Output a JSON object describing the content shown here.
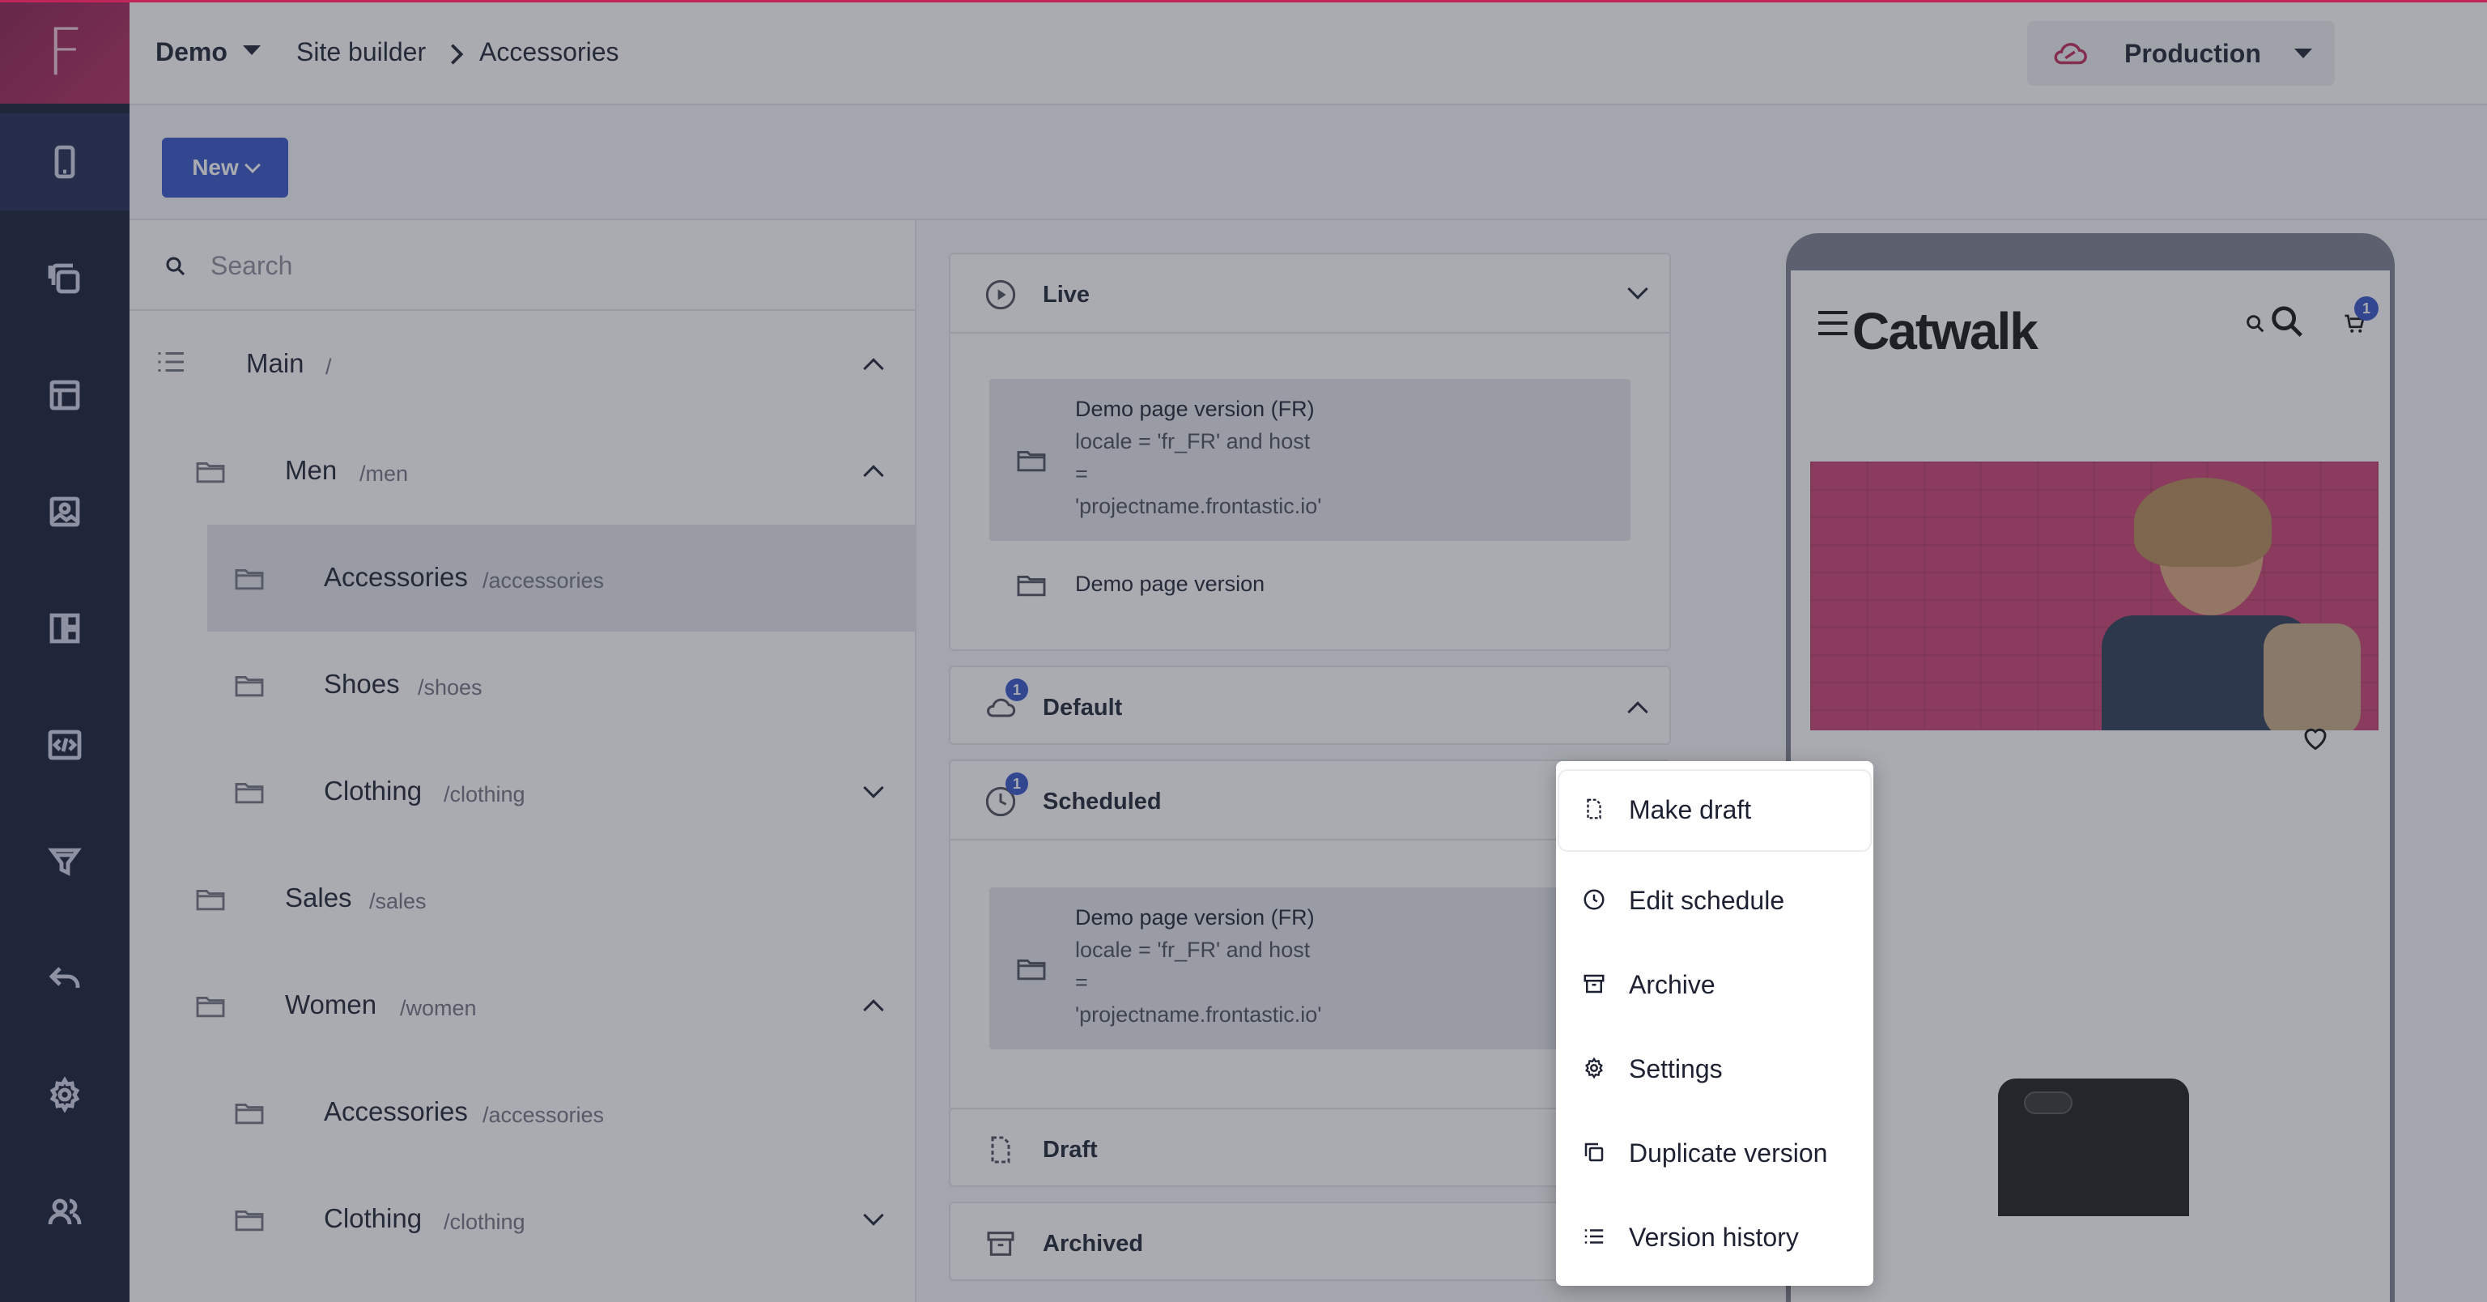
{
  "topbar": {
    "project": "Demo",
    "breadcrumb": [
      "Site builder",
      "Accessories"
    ],
    "environment": "Production"
  },
  "toolbar": {
    "new_label": "New"
  },
  "search": {
    "placeholder": "Search"
  },
  "tree": [
    {
      "name": "Main",
      "path": "/"
    },
    {
      "name": "Men",
      "path": "/men"
    },
    {
      "name": "Accessories",
      "path": "/accessories"
    },
    {
      "name": "Shoes",
      "path": "/shoes"
    },
    {
      "name": "Clothing",
      "path": "/clothing"
    },
    {
      "name": "Sales",
      "path": "/sales"
    },
    {
      "name": "Women",
      "path": "/women"
    },
    {
      "name": "Accessories",
      "path": "/accessories"
    },
    {
      "name": "Clothing",
      "path": "/clothing"
    }
  ],
  "versions": {
    "live": {
      "title": "Live",
      "items": [
        {
          "name": "Demo page version (FR)",
          "condition": [
            "locale = 'fr_FR' and host",
            "=",
            "'projectname.frontastic.io'"
          ]
        },
        {
          "name": "Demo page version"
        }
      ]
    },
    "default": {
      "title": "Default",
      "badge": "1"
    },
    "scheduled": {
      "title": "Scheduled",
      "badge": "1",
      "items": [
        {
          "name": "Demo page version (FR)",
          "condition": [
            "locale = 'fr_FR' and host",
            "=",
            "'projectname.frontastic.io'"
          ]
        }
      ]
    },
    "draft": {
      "title": "Draft"
    },
    "archived": {
      "title": "Archived"
    }
  },
  "preview": {
    "brand": "Catwalk",
    "cart_count": "1"
  },
  "context_menu": [
    "Make draft",
    "Edit schedule",
    "Archive",
    "Settings",
    "Duplicate version",
    "Version history"
  ],
  "colors": {
    "accent": "#3553c9",
    "rail": "#141a33",
    "brand": "#b22a5c"
  }
}
